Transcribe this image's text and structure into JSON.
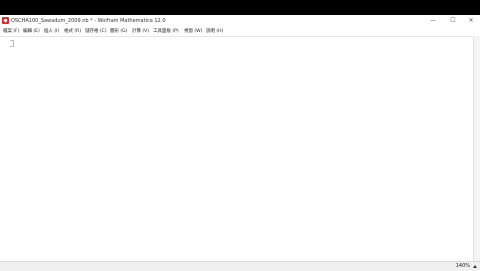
{
  "window": {
    "title": "OSCHA100_Sawadum_2009.nb * - Wolfram Mathematica 12.0",
    "controls": {
      "minimize": "—",
      "maximize": "☐",
      "close": "✕"
    }
  },
  "menubar": {
    "items": [
      "檔案 (F)",
      "編輯 (E)",
      "插入 (I)",
      "格式 (R)",
      "儲存格 (C)",
      "圖形 (G)",
      "計算 (V)",
      "工具面板 (P)",
      "視窗 (W)",
      "說明 (H)"
    ]
  },
  "statusbar": {
    "zoom": "140%"
  },
  "colors": {
    "app_icon": "#d8262b",
    "background": "#000000",
    "window": "#ffffff"
  }
}
